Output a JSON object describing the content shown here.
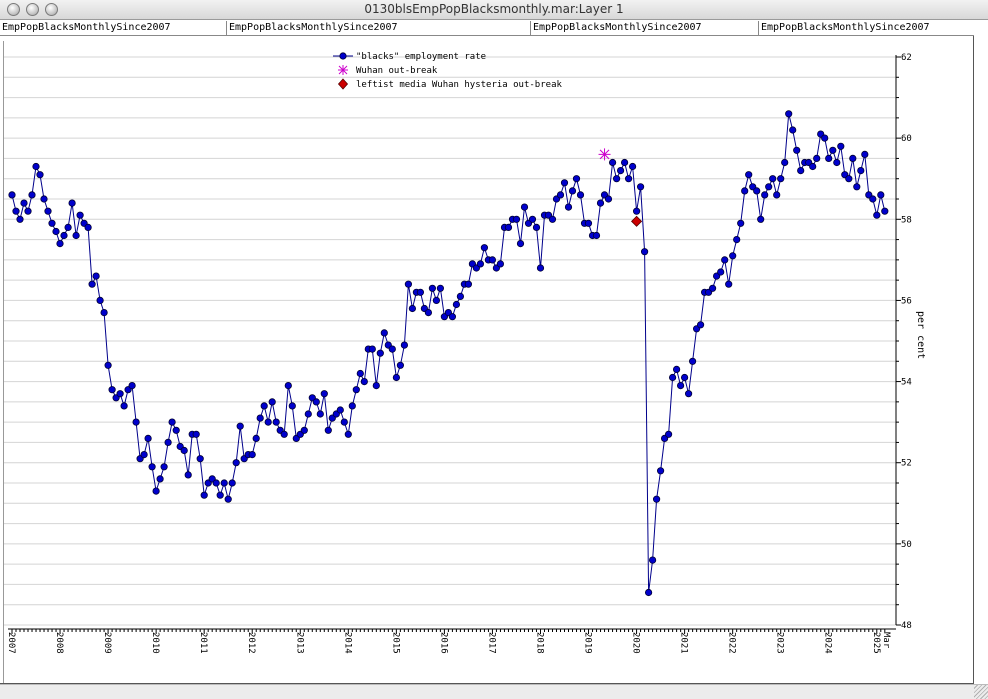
{
  "window": {
    "title": "0130blsEmpPopBlacksmonthly.mar:Layer 1"
  },
  "series_bar": {
    "labels": [
      "EmpPopBlacksMonthlySince2007",
      "EmpPopBlacksMonthlySince2007",
      "EmpPopBlacksMonthlySince2007",
      "EmpPopBlacksMonthlySince2007"
    ]
  },
  "colors": {
    "series_line": "#00008b",
    "series_marker": "#0000cc",
    "wuhan_marker": "#cc00cc",
    "hysteria_marker": "#cc0000",
    "grid": "#d4d4d4"
  },
  "chart_data": {
    "type": "line",
    "ylabel": "per cent",
    "ylim": [
      48,
      62
    ],
    "y_ticks": [
      48,
      50,
      52,
      54,
      56,
      58,
      60,
      62
    ],
    "xlim": [
      2007.0,
      2025.15
    ],
    "x_ticks": [
      "2007",
      "2008",
      "2009",
      "2010",
      "2011",
      "2012",
      "2013",
      "2014",
      "2015",
      "2016",
      "2017",
      "2018",
      "2019",
      "2020",
      "2021",
      "2022",
      "2023",
      "2024",
      "2025"
    ],
    "x_end_label": "Mar",
    "grid": true,
    "legend_position": "top-center",
    "legend": [
      {
        "label": "\"blacks\" employment rate",
        "marker": "circle"
      },
      {
        "label": "Wuhan out-break",
        "marker": "asterisk"
      },
      {
        "label": "leftist media Wuhan hysteria out-break",
        "marker": "diamond"
      }
    ],
    "series": [
      {
        "name": "\"blacks\" employment rate",
        "start": "2007-01",
        "values": [
          58.6,
          58.2,
          58.0,
          58.4,
          58.2,
          58.6,
          59.3,
          59.1,
          58.5,
          58.2,
          57.9,
          57.7,
          57.4,
          57.6,
          57.8,
          58.4,
          57.6,
          58.1,
          57.9,
          57.8,
          56.4,
          56.6,
          56.0,
          55.7,
          54.4,
          53.8,
          53.6,
          53.7,
          53.4,
          53.8,
          53.9,
          53.0,
          52.1,
          52.2,
          52.6,
          51.9,
          51.3,
          51.6,
          51.9,
          52.5,
          53.0,
          52.8,
          52.4,
          52.3,
          51.7,
          52.7,
          52.7,
          52.1,
          51.2,
          51.5,
          51.6,
          51.5,
          51.2,
          51.5,
          51.1,
          51.5,
          52.0,
          52.9,
          52.1,
          52.2,
          52.2,
          52.6,
          53.1,
          53.4,
          53.0,
          53.5,
          53.0,
          52.8,
          52.7,
          53.9,
          53.4,
          52.6,
          52.7,
          52.8,
          53.2,
          53.6,
          53.5,
          53.2,
          53.7,
          52.8,
          53.1,
          53.2,
          53.3,
          53.0,
          52.7,
          53.4,
          53.8,
          54.2,
          54.0,
          54.8,
          54.8,
          53.9,
          54.7,
          55.2,
          54.9,
          54.8,
          54.1,
          54.4,
          54.9,
          56.4,
          55.8,
          56.2,
          56.2,
          55.8,
          55.7,
          56.3,
          56.0,
          56.3,
          55.6,
          55.7,
          55.6,
          55.9,
          56.1,
          56.4,
          56.4,
          56.9,
          56.8,
          56.9,
          57.3,
          57.0,
          57.0,
          56.8,
          56.9,
          57.8,
          57.8,
          58.0,
          58.0,
          57.4,
          58.3,
          57.9,
          58.0,
          57.8,
          56.8,
          58.1,
          58.1,
          58.0,
          58.5,
          58.6,
          58.9,
          58.3,
          58.7,
          59.0,
          58.6,
          57.9,
          57.9,
          57.6,
          57.6,
          58.4,
          58.6,
          58.5,
          59.4,
          59.0,
          59.2,
          59.4,
          59.0,
          59.3,
          58.2,
          58.8,
          57.2,
          48.8,
          49.6,
          51.1,
          51.8,
          52.6,
          52.7,
          54.1,
          54.3,
          53.9,
          54.1,
          53.7,
          54.5,
          55.3,
          55.4,
          56.2,
          56.2,
          56.3,
          56.6,
          56.7,
          57.0,
          56.4,
          57.1,
          57.5,
          57.9,
          58.7,
          59.1,
          58.8,
          58.7,
          58.0,
          58.6,
          58.8,
          59.0,
          58.6,
          59.0,
          59.4,
          60.6,
          60.2,
          59.7,
          59.2,
          59.4,
          59.4,
          59.3,
          59.5,
          60.1,
          60.0,
          59.5,
          59.7,
          59.4,
          59.8,
          59.1,
          59.0,
          59.5,
          58.8,
          59.2,
          59.6,
          58.6,
          58.5,
          58.1,
          58.6,
          58.2
        ]
      }
    ],
    "annotations": [
      {
        "label": "Wuhan out-break",
        "marker": "asterisk",
        "x": "2019-05",
        "y": 59.6
      },
      {
        "label": "leftist media Wuhan hysteria out-break",
        "marker": "diamond",
        "x": "2020-01",
        "y": 57.95
      }
    ]
  }
}
